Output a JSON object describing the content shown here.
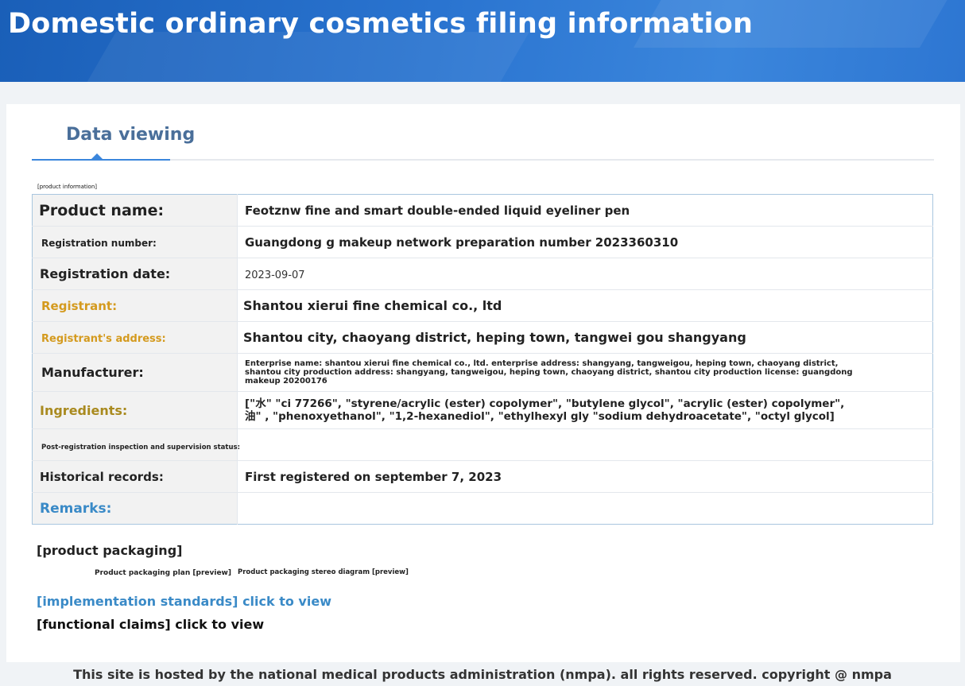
{
  "header": {
    "title": "Domestic ordinary cosmetics filing information"
  },
  "tabs": {
    "active_label": "Data viewing"
  },
  "product_info": {
    "section_label": "[product information]",
    "rows": [
      {
        "label": "Product name:",
        "value": "Feotznw fine and smart double-ended liquid eyeliner pen"
      },
      {
        "label": "Registration number:",
        "value": "Guangdong g makeup network preparation number 2023360310"
      },
      {
        "label": "Registration date:",
        "value": "2023-09-07"
      },
      {
        "label": "Registrant:",
        "value": "Shantou xierui fine chemical co., ltd"
      },
      {
        "label": "Registrant's address:",
        "value": "Shantou city, chaoyang district, heping town, tangwei gou shangyang"
      },
      {
        "label": "Manufacturer:",
        "value": "Enterprise name: shantou xierui fine chemical co., ltd. enterprise address: shangyang, tangweigou, heping town, chaoyang district, shantou city production address: shangyang, tangweigou, heping town, chaoyang district, shantou city production license: guangdong makeup 20200176"
      },
      {
        "label": "Ingredients:",
        "value_line1": "[\"水\" \"ci 77266\", \"styrene/acrylic (ester) copolymer\", \"butylene glycol\", \"acrylic (ester) copolymer\",",
        "value_line2": "油\" , \"phenoxyethanol\", \"1,2-hexanediol\", \"ethylhexyl gly \"sodium dehydroacetate\", \"octyl glycol]"
      },
      {
        "label": "Post-registration inspection and supervision status:",
        "value": ""
      },
      {
        "label": "Historical records:",
        "value": "First registered on september 7, 2023"
      },
      {
        "label": "Remarks:",
        "value": ""
      }
    ]
  },
  "packaging": {
    "title": "[product packaging]",
    "plan_preview": "Product packaging plan [preview]",
    "stereo_preview": "Product packaging stereo diagram [preview]"
  },
  "links": {
    "standards": "[implementation standards] click to view",
    "claims": "[functional claims] click to view"
  },
  "footer": {
    "text": "This site is hosted by the national medical products administration (nmpa). all rights reserved. copyright @ nmpa"
  },
  "colors": {
    "banner": "#2a74d0",
    "label_gold": "#d49a1e",
    "label_olive": "#a98a1f",
    "label_blue": "#3a8ac7",
    "table_border": "#a9c6df"
  }
}
